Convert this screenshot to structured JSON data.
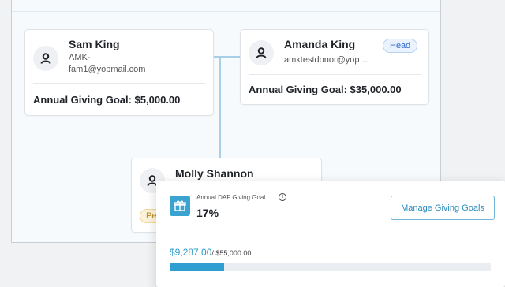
{
  "family_tree": {
    "members": [
      {
        "name": "Sam King",
        "email_line1": "AMK-",
        "email_line2": "fam1@yopmail.com",
        "goal": "Annual Giving Goal: $5,000.00"
      },
      {
        "name": "Amanda King",
        "email": "amktestdonor@yop…",
        "badge": "Head",
        "goal": "Annual Giving Goal: $35,000.00"
      },
      {
        "name": "Molly Shannon",
        "status_badge": "Pe"
      }
    ]
  },
  "daf_goal": {
    "label": "Annual DAF Giving Goal",
    "info_glyph": "i",
    "percent": "17%",
    "manage_button": "Manage Giving Goals",
    "amount_current": "$9,287.00",
    "amount_total": "/ $55,000.00",
    "progress_fraction": 0.169
  },
  "colors": {
    "accent": "#2e9fd0",
    "head_badge": "#2d6ac9",
    "pending_badge": "#b98a1d"
  },
  "icons": {
    "avatar": "person-icon",
    "gift": "gift-icon",
    "info": "info-icon"
  }
}
